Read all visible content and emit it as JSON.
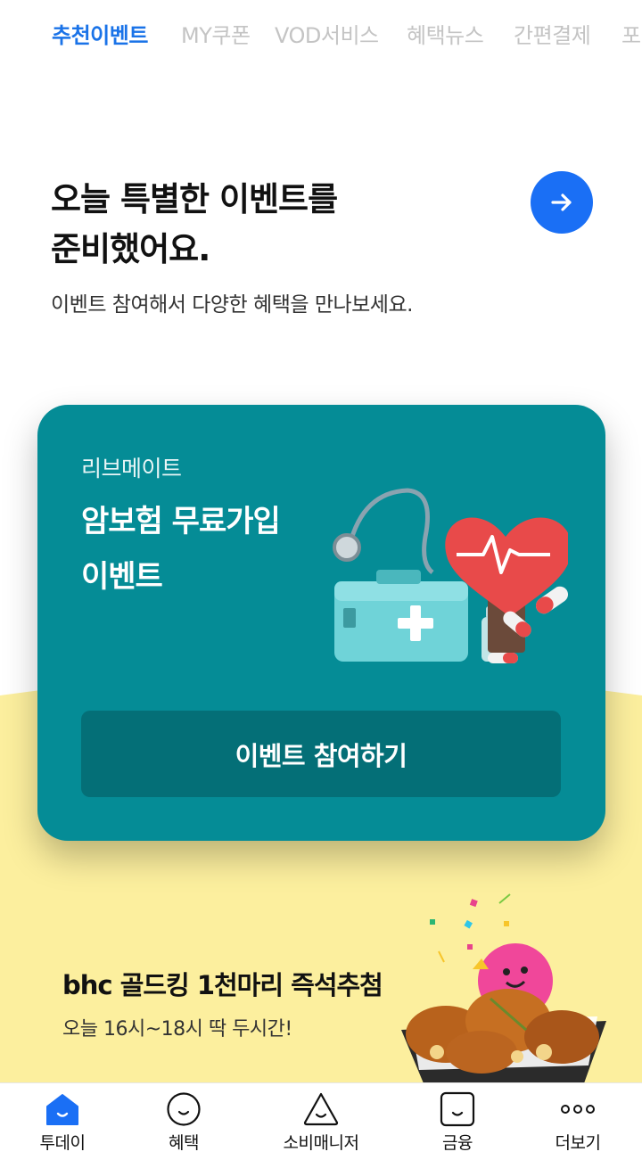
{
  "tabs": [
    {
      "label": "추천이벤트",
      "active": true
    },
    {
      "label": "MY쿠폰",
      "active": false
    },
    {
      "label": "VOD서비스",
      "active": false
    },
    {
      "label": "혜택뉴스",
      "active": false
    },
    {
      "label": "간편결제",
      "active": false
    },
    {
      "label": "포",
      "active": false
    }
  ],
  "hero": {
    "title_line1": "오늘 특별한 이벤트를",
    "title_line2": "준비했어요.",
    "subtitle": "이벤트 참여해서 다양한 혜택을 만나보세요.",
    "arrow_icon": "arrow-right-icon"
  },
  "event_card": {
    "brand": "리브메이트",
    "title_line1": "암보험 무료가입",
    "title_line2": "이벤트",
    "button_label": "이벤트 참여하기",
    "illustration": "medical-kit-heart-illustration",
    "bg_color": "#058c96",
    "button_color": "#046f77"
  },
  "promo": {
    "title": "bhc 골드킹 1천마리 즉석추첨",
    "subtitle": "오늘 16시~18시 딱 두시간!",
    "illustration": "fried-chicken-basket-illustration",
    "bg_color": "#fcef9e"
  },
  "bottom_nav": [
    {
      "label": "투데이",
      "icon": "home-smile-icon",
      "active": true
    },
    {
      "label": "혜택",
      "icon": "circle-smile-icon",
      "active": false
    },
    {
      "label": "소비매니저",
      "icon": "triangle-smile-icon",
      "active": false
    },
    {
      "label": "금융",
      "icon": "square-smile-icon",
      "active": false
    },
    {
      "label": "더보기",
      "icon": "more-dots-icon",
      "active": false
    }
  ],
  "colors": {
    "accent": "#1a6ff5",
    "active_tab": "#1a73e8"
  }
}
